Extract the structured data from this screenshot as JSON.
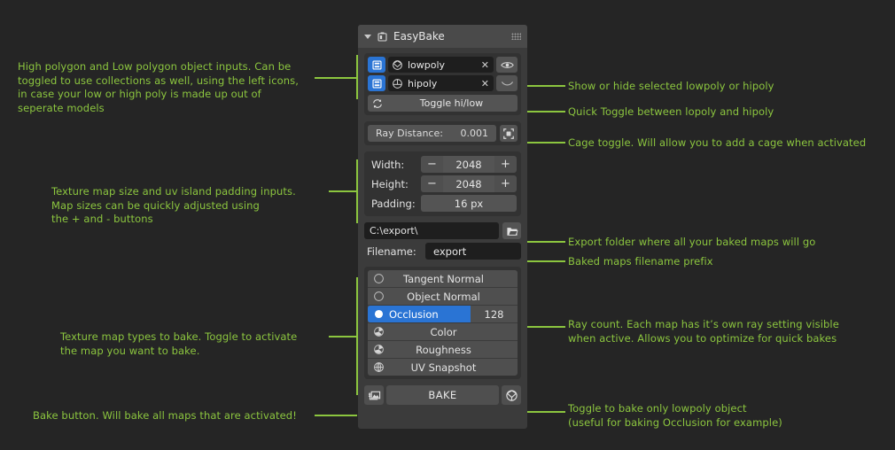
{
  "panel": {
    "title": "EasyBake",
    "objects": [
      {
        "name": "lowpoly",
        "clear": "✕",
        "icon": "mesh-icon",
        "collection_icon": "collection-icon",
        "visibility_icon": "eye-icon"
      },
      {
        "name": "hipoly",
        "clear": "✕",
        "icon": "sphere-icon",
        "collection_icon": "collection-icon",
        "visibility_icon": "eye-closed-icon"
      }
    ],
    "toggle_hi_low": "Toggle hi/low",
    "ray_distance": {
      "label": "Ray Distance:",
      "value": "0.001"
    },
    "size": {
      "width": {
        "label": "Width:",
        "value": "2048",
        "minus": "−",
        "plus": "+"
      },
      "height": {
        "label": "Height:",
        "value": "2048",
        "minus": "−",
        "plus": "+"
      },
      "padding": {
        "label": "Padding:",
        "value": "16 px"
      }
    },
    "export": {
      "path": "C:\\export\\",
      "filename_label": "Filename:",
      "filename": "export"
    },
    "maps": [
      {
        "label": "Tangent Normal",
        "active": false,
        "icon": "shading-icon",
        "rays": ""
      },
      {
        "label": "Object Normal",
        "active": false,
        "icon": "shading-icon",
        "rays": ""
      },
      {
        "label": "Occlusion",
        "active": true,
        "icon": "sphere-white-icon",
        "rays": "128"
      },
      {
        "label": "Color",
        "active": false,
        "icon": "shading-icon",
        "rays": ""
      },
      {
        "label": "Roughness",
        "active": false,
        "icon": "shading-icon",
        "rays": ""
      },
      {
        "label": "UV Snapshot",
        "active": false,
        "icon": "uv-globe-icon",
        "rays": ""
      }
    ],
    "bake": {
      "label": "BAKE",
      "left_icon": "render-image-icon",
      "right_icon": "lowpoly-only-toggle-icon"
    }
  },
  "annotations": {
    "left": [
      {
        "id": "objects-note",
        "text": "High polygon and Low polygon object inputs. Can be\ntoggled to use collections as well, using the left icons,\nin case your low or high poly is made up out of\nseperate models"
      },
      {
        "id": "size-note",
        "text": "Texture map size and uv island padding inputs.\nMap sizes can be quickly adjusted using\nthe + and - buttons"
      },
      {
        "id": "maps-note",
        "text": "Texture map types to bake. Toggle to activate\nthe map you want to bake."
      },
      {
        "id": "bake-note",
        "text": "Bake button. Will bake all maps that are activated!"
      }
    ],
    "right": [
      {
        "id": "visibility-note",
        "text": "Show or hide selected lowpoly or hipoly"
      },
      {
        "id": "toggle-note",
        "text": "Quick Toggle between lopoly and hipoly"
      },
      {
        "id": "cage-note",
        "text": "Cage toggle. Will allow you to add a cage when activated"
      },
      {
        "id": "export-folder-note",
        "text": "Export folder where all your baked maps will go"
      },
      {
        "id": "filename-note",
        "text": "Baked maps filename prefix"
      },
      {
        "id": "rays-note",
        "text": "Ray count. Each map has it’s own ray setting visible\nwhen active. Allows you to optimize for quick bakes"
      },
      {
        "id": "lowpoly-only-note",
        "text": "Toggle to bake only lowpoly object\n(useful for baking Occlusion for example)"
      }
    ]
  },
  "colors": {
    "accent_green": "#8cc63f",
    "panel_bg": "#3b3b3b",
    "group_bg": "#323232",
    "widget": "#545454",
    "field_dark": "#1e1e1e",
    "blue": "#2a74d4",
    "background": "#252525"
  }
}
